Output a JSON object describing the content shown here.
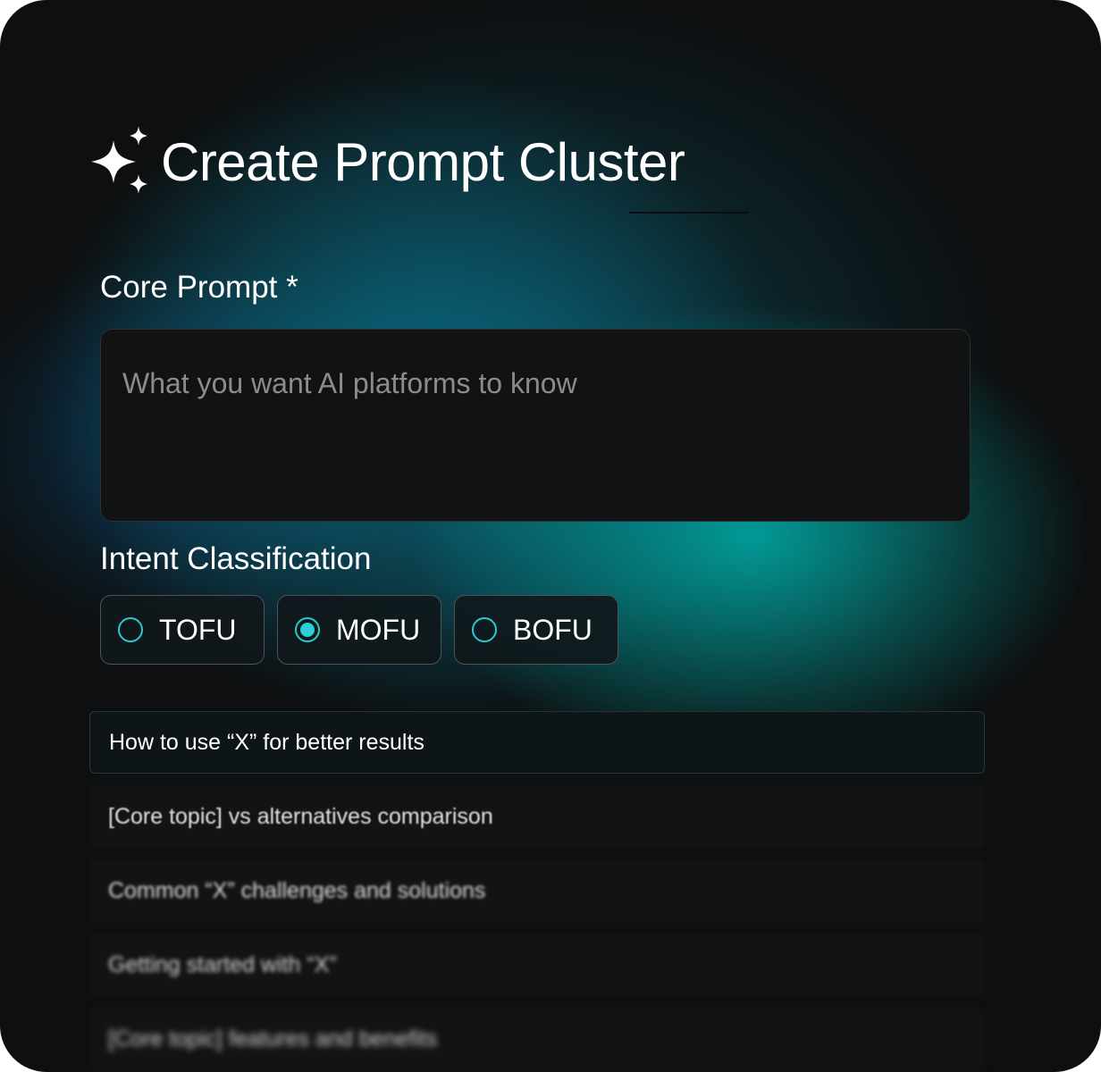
{
  "title": "Create Prompt Cluster",
  "core_prompt": {
    "label": "Core Prompt *",
    "placeholder": "What you want AI platforms to know",
    "value": ""
  },
  "intent": {
    "label": "Intent Classification",
    "options": [
      {
        "label": "TOFU",
        "selected": false
      },
      {
        "label": "MOFU",
        "selected": true
      },
      {
        "label": "BOFU",
        "selected": false
      }
    ]
  },
  "suggestions": [
    "How to use “X” for better results",
    "[Core topic] vs alternatives comparison",
    "Common “X” challenges and solutions",
    "Getting started with “X”",
    "[Core topic] features and benefits"
  ],
  "colors": {
    "accent": "#2bd0d6",
    "background": "#0d0f10"
  }
}
